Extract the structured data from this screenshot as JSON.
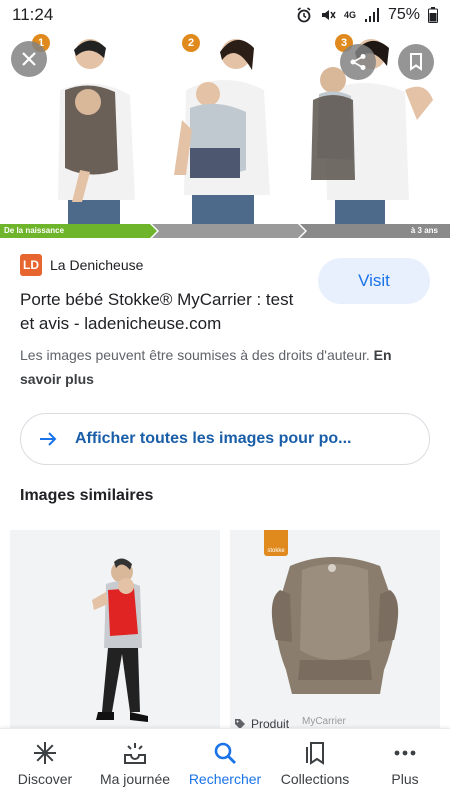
{
  "status_bar": {
    "time": "11:24",
    "battery": "75%",
    "network": "4G"
  },
  "hero": {
    "steps": [
      "1",
      "2",
      "3"
    ],
    "progress_left": "De la naissance",
    "progress_right": "à 3 ans"
  },
  "source": {
    "logo": "LD",
    "name": "La Denicheuse"
  },
  "visit_label": "Visit",
  "title": "Porte bébé Stokke® MyCarrier : test et avis - ladenicheuse.com",
  "copyright": {
    "text": "Les images peuvent être soumises à des droits d'auteur.",
    "link": "En savoir plus"
  },
  "all_images_label": "Afficher toutes les images pour po...",
  "similar_heading": "Images similaires",
  "similar_items": [
    {
      "product_label": ""
    },
    {
      "badge": "stokke",
      "product_label": "Produit",
      "watermark": "MyCarrier"
    }
  ],
  "bottom_nav": {
    "items": [
      {
        "label": "Discover",
        "icon": "asterisk-icon"
      },
      {
        "label": "Ma journée",
        "icon": "inbox-sunrise-icon"
      },
      {
        "label": "Rechercher",
        "icon": "search-icon",
        "active": true
      },
      {
        "label": "Collections",
        "icon": "bookmark-stack-icon"
      },
      {
        "label": "Plus",
        "icon": "more-horiz-icon"
      }
    ]
  },
  "colors": {
    "accent": "#1a73e8",
    "visit_bg": "#e8f0fe",
    "progress_green": "#6fb52c",
    "progress_grey": "#9a9a9a",
    "step_orange": "#e08a1e"
  }
}
